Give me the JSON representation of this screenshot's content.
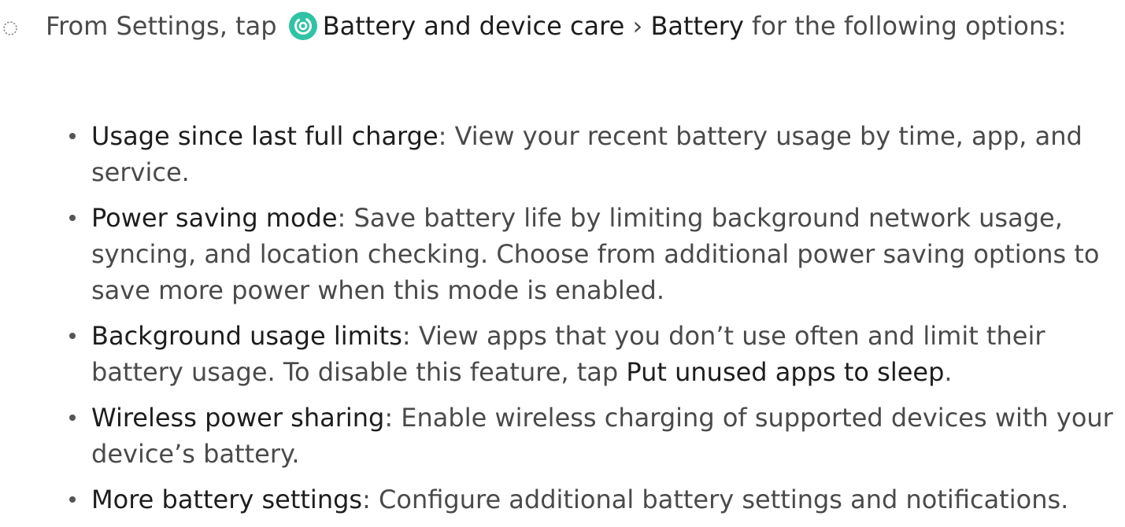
{
  "step": {
    "prefix": "From Settings, tap",
    "icon": "battery-device-care-icon",
    "icon_color": "#2fc3a4",
    "path_first": "Battery and device care",
    "separator": "›",
    "path_second": "Battery",
    "suffix": "for the following",
    "suffix2": "options:"
  },
  "items": [
    {
      "term": "Usage since last full charge",
      "text": ": View your recent battery usage by time, app, and service."
    },
    {
      "term": "Power saving mode",
      "text": ": Save battery life by limiting background network usage, syncing, and location checking. Choose from additional power saving options to save more power when this mode is enabled."
    },
    {
      "term": "Background usage limits",
      "text": ": View apps that you don’t use often and limit their battery usage. To disable this feature, tap ",
      "link": "Put unused apps to sleep",
      "end": "."
    },
    {
      "term": "Wireless power sharing",
      "text": ": Enable wireless charging of supported devices with your device’s battery."
    },
    {
      "term": "More battery settings",
      "text": ": Configure additional battery settings and notifications."
    }
  ]
}
